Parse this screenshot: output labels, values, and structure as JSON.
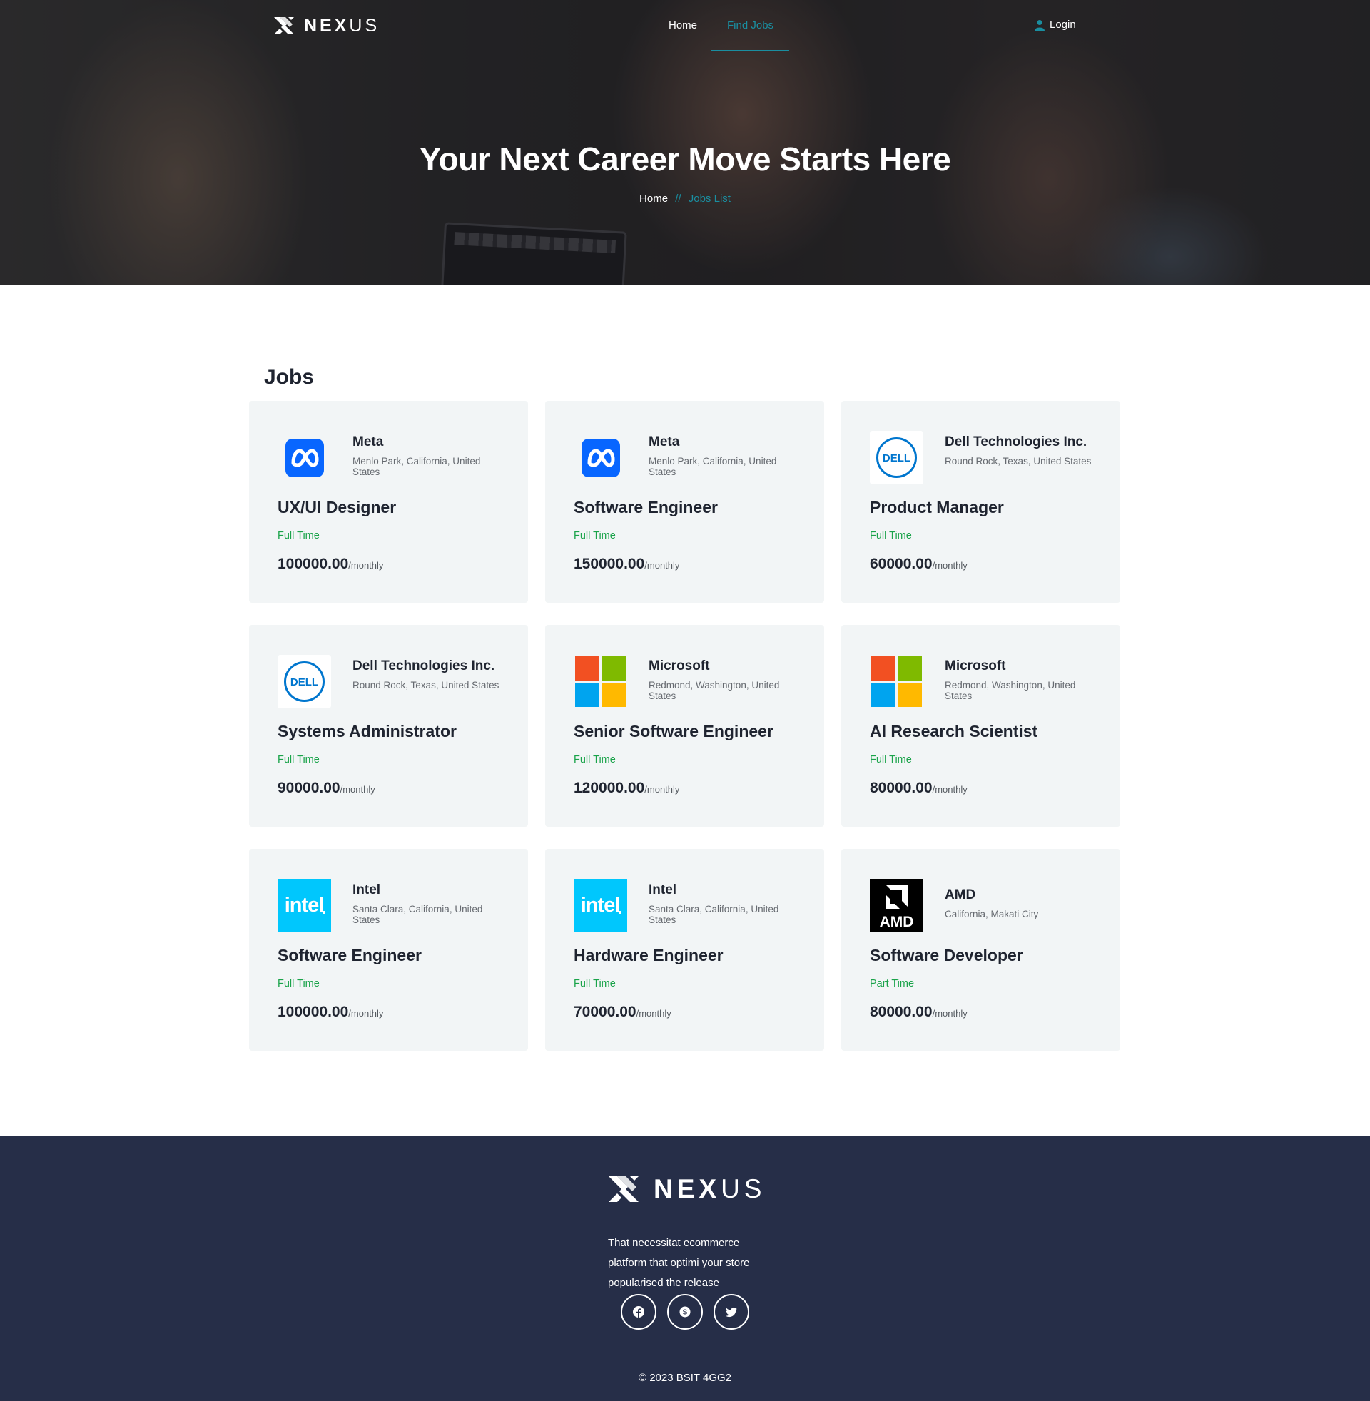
{
  "brand": {
    "name_bold": "NEX",
    "name_thin": "US"
  },
  "nav": {
    "links": [
      {
        "label": "Home",
        "active": false
      },
      {
        "label": "Find Jobs",
        "active": true
      }
    ],
    "login_label": "Login"
  },
  "hero": {
    "title": "Your Next Career Move Starts Here",
    "breadcrumb": {
      "home": "Home",
      "separator": "//",
      "current": "Jobs List"
    }
  },
  "jobs": {
    "heading": "Jobs",
    "per_label": "/monthly",
    "list": [
      {
        "company": "Meta",
        "location": "Menlo Park, California, United States",
        "logo": "meta-logo",
        "title": "UX/UI Designer",
        "type": "Full Time",
        "pay": "100000.00"
      },
      {
        "company": "Meta",
        "location": "Menlo Park, California, United States",
        "logo": "meta-logo",
        "title": "Software Engineer",
        "type": "Full Time",
        "pay": "150000.00"
      },
      {
        "company": "Dell Technologies Inc.",
        "location": "Round Rock, Texas, United States",
        "logo": "dell-logo",
        "title": "Product Manager",
        "type": "Full Time",
        "pay": "60000.00"
      },
      {
        "company": "Dell Technologies Inc.",
        "location": "Round Rock, Texas, United States",
        "logo": "dell-logo",
        "title": "Systems Administrator",
        "type": "Full Time",
        "pay": "90000.00"
      },
      {
        "company": "Microsoft",
        "location": "Redmond, Washington, United States",
        "logo": "microsoft-logo",
        "title": "Senior Software Engineer",
        "type": "Full Time",
        "pay": "120000.00"
      },
      {
        "company": "Microsoft",
        "location": "Redmond, Washington, United States",
        "logo": "microsoft-logo",
        "title": "AI Research Scientist",
        "type": "Full Time",
        "pay": "80000.00"
      },
      {
        "company": "Intel",
        "location": "Santa Clara, California, United States",
        "logo": "intel-logo",
        "title": "Software Engineer",
        "type": "Full Time",
        "pay": "100000.00"
      },
      {
        "company": "Intel",
        "location": "Santa Clara, California, United States",
        "logo": "intel-logo",
        "title": "Hardware Engineer",
        "type": "Full Time",
        "pay": "70000.00"
      },
      {
        "company": "AMD",
        "location": "California, Makati City",
        "logo": "amd-logo",
        "title": "Software Developer",
        "type": "Part Time",
        "pay": "80000.00"
      }
    ]
  },
  "footer": {
    "about": "That necessitat ecommerce platform that optimi your store popularised the release",
    "socials": [
      "facebook-icon",
      "skype-icon",
      "twitter-icon"
    ],
    "copyright": "© 2023 BSIT 4GG2"
  },
  "colors": {
    "accent": "#1a8ea0",
    "job_type_green": "#1aa34a",
    "card_bg": "#f2f5f6",
    "footer_bg": "#262e48",
    "meta_blue": "#0866ff",
    "dell_blue": "#0076ce",
    "intel_blue": "#00c7fd",
    "ms_red": "#f25022",
    "ms_green": "#7fba00",
    "ms_blue": "#00a4ef",
    "ms_yellow": "#ffb900"
  }
}
